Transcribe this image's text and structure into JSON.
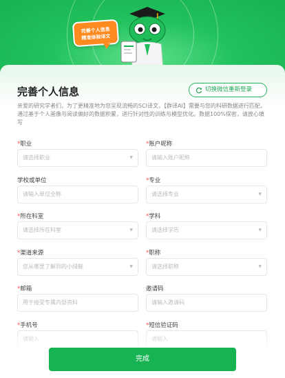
{
  "hero": {
    "bubble_line1": "完善个人信息",
    "bubble_line2": "精准体验译文"
  },
  "header": {
    "title": "完善个人信息",
    "switch_label": "切换微信重新登录"
  },
  "description": "亲爱的研究学者们，为了更精准地为您呈现流畅的SCI译文，【群译AI】需要与您的科研数据进行匹配，通过基于个人画像与阅读偏好的数据积累，进行针对性的训练与模型优化。数据100%保密，请放心填写",
  "fields": [
    {
      "label": "职业",
      "required": true,
      "placeholder": "请选择职业",
      "select": true
    },
    {
      "label": "账户昵称",
      "required": true,
      "placeholder": "请输入账户昵称",
      "select": false
    },
    {
      "label": "学校或单位",
      "required": false,
      "placeholder": "请输入单位全称",
      "select": false
    },
    {
      "label": "专业",
      "required": true,
      "placeholder": "请选择专业",
      "select": true
    },
    {
      "label": "所在科室",
      "required": true,
      "placeholder": "请选择所在科室",
      "select": true
    },
    {
      "label": "学科",
      "required": true,
      "placeholder": "请选择学历",
      "select": true
    },
    {
      "label": "渠道来源",
      "required": true,
      "placeholder": "您从哪里了解到的小绿鲸",
      "select": true
    },
    {
      "label": "职称",
      "required": true,
      "placeholder": "请选择职称",
      "select": true
    },
    {
      "label": "邮箱",
      "required": true,
      "placeholder": "用于接受专属内部资料",
      "select": false
    },
    {
      "label": "邀请码",
      "required": false,
      "placeholder": "请输入邀请码",
      "select": false
    },
    {
      "label": "手机号",
      "required": true,
      "placeholder": "请输入",
      "select": false
    },
    {
      "label": "短信验证码",
      "required": true,
      "placeholder": "请输入",
      "select": false
    }
  ],
  "submit_label": "完成",
  "colors": {
    "brand_green": "#17b352",
    "required_red": "#ff4d4f",
    "bubble_orange": "#ff8a1f"
  }
}
